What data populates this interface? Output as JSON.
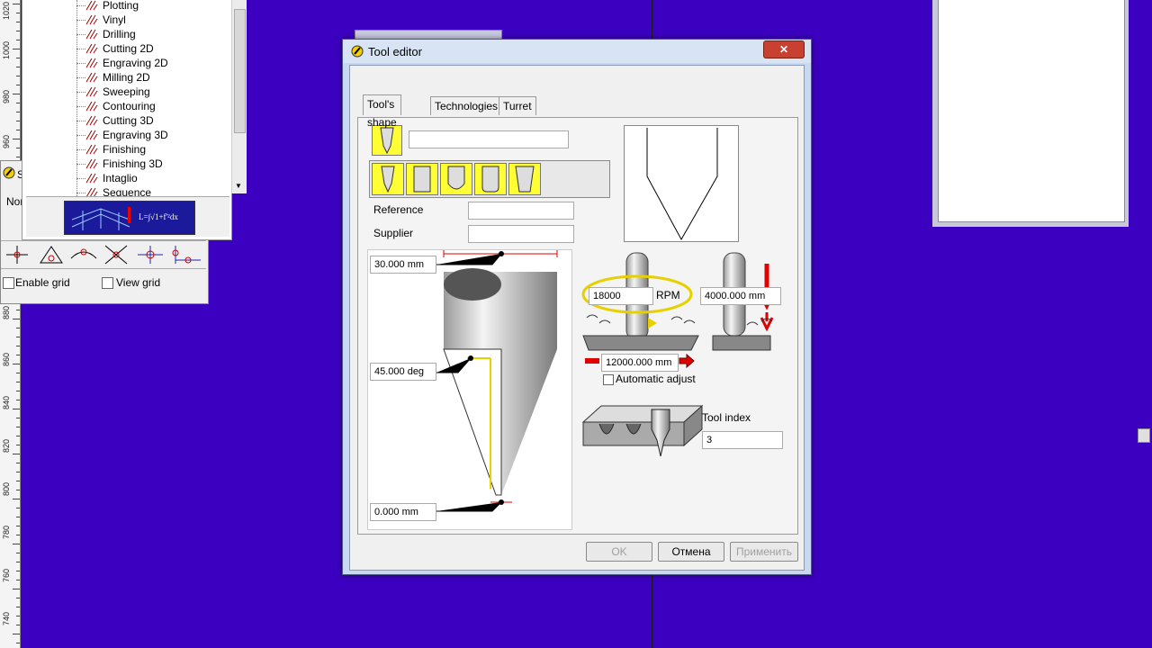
{
  "ruler_left": {
    "labels": [
      "1020",
      "1000",
      "980",
      "960",
      "880",
      "860",
      "840",
      "820",
      "800",
      "780",
      "760",
      "740"
    ]
  },
  "tree": {
    "items": [
      {
        "label": "Plotting"
      },
      {
        "label": "Vinyl"
      },
      {
        "label": "Drilling"
      },
      {
        "label": "Cutting 2D"
      },
      {
        "label": "Engraving 2D"
      },
      {
        "label": "Milling 2D"
      },
      {
        "label": "Sweeping"
      },
      {
        "label": "Contouring"
      },
      {
        "label": "Cutting 3D"
      },
      {
        "label": "Engraving 3D"
      },
      {
        "label": "Finishing"
      },
      {
        "label": "Finishing 3D"
      },
      {
        "label": "Intaglio"
      },
      {
        "label": "Sequence"
      }
    ]
  },
  "snap_panel": {
    "tab_label": "Nor",
    "side_letter": "S",
    "enable_grid": "Enable grid",
    "view_grid": "View grid"
  },
  "dialog": {
    "title": "Tool editor",
    "close_glyph": "✕",
    "tabs": [
      {
        "label": "Tool's shape"
      },
      {
        "label": "Technologies"
      },
      {
        "label": "Turret"
      }
    ],
    "tool_name_value": "",
    "reference_label": "Reference",
    "reference_value": "",
    "supplier_label": "Supplier",
    "supplier_value": "",
    "diameter_value": "30.000 mm",
    "angle_value": "45.000 deg",
    "tip_value": "0.000 mm",
    "spindle_speed_value": "18000",
    "rpm_label": "RPM",
    "plunge_feed_value": "4000.000 mm",
    "feed_value": "12000.000 mm",
    "auto_adjust_label": "Automatic adjust",
    "tool_index_label": "Tool index",
    "tool_index_value": "3",
    "ok_label": "OK",
    "cancel_label": "Отмена",
    "apply_label": "Применить"
  },
  "colors": {
    "desktop": "#3c00c0",
    "highlight": "#ffff33",
    "arrow": "#e00000"
  }
}
